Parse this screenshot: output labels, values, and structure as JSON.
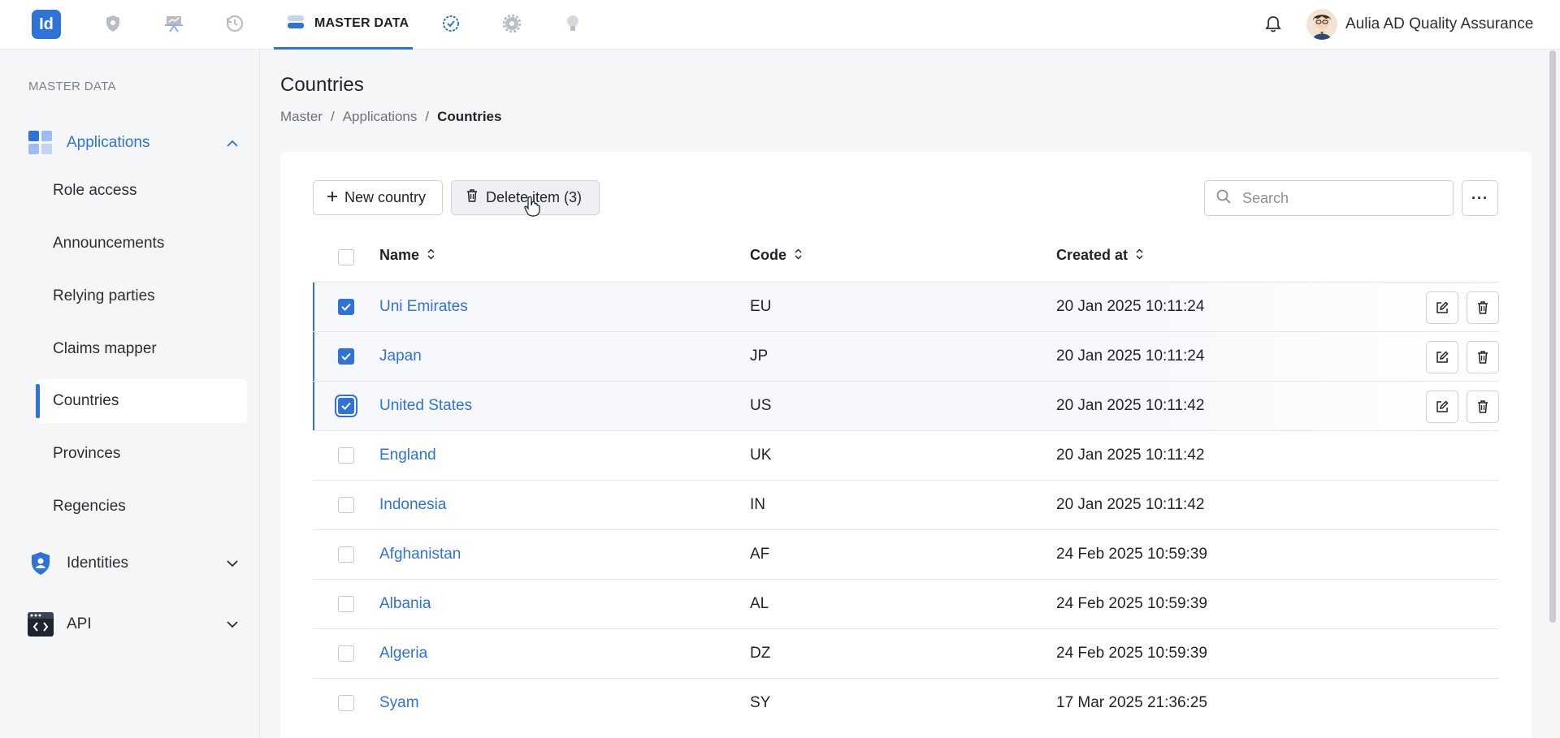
{
  "app": {
    "logo_text": "Id"
  },
  "topnav": {
    "active_label": "MASTER DATA",
    "icons": [
      "shield-icon",
      "presentation-icon",
      "history-icon",
      "master-data-icon",
      "check-circle-icon",
      "gear-icon",
      "lightbulb-icon"
    ]
  },
  "user": {
    "name": "Aulia AD Quality Assurance"
  },
  "sidebar": {
    "section_label": "MASTER DATA",
    "groups": {
      "applications": "Applications",
      "identities": "Identities",
      "api": "API"
    },
    "items": [
      {
        "label": "Role access"
      },
      {
        "label": "Announcements"
      },
      {
        "label": "Relying parties"
      },
      {
        "label": "Claims mapper"
      },
      {
        "label": "Countries"
      },
      {
        "label": "Provinces"
      },
      {
        "label": "Regencies"
      }
    ],
    "active_item": "Countries"
  },
  "page": {
    "title": "Countries",
    "breadcrumb": [
      "Master",
      "Applications",
      "Countries"
    ]
  },
  "toolbar": {
    "new_label": "New country",
    "delete_label": "Delete item (3)",
    "search_placeholder": "Search",
    "more_label": "···"
  },
  "table": {
    "columns": [
      "Name",
      "Code",
      "Created at"
    ],
    "rows": [
      {
        "name": "Uni Emirates",
        "code": "EU",
        "created": "20 Jan 2025 10:11:24",
        "selected": true
      },
      {
        "name": "Japan",
        "code": "JP",
        "created": "20 Jan 2025 10:11:24",
        "selected": true
      },
      {
        "name": "United States",
        "code": "US",
        "created": "20 Jan 2025 10:11:42",
        "selected": true
      },
      {
        "name": "England",
        "code": "UK",
        "created": "20 Jan 2025 10:11:42",
        "selected": false
      },
      {
        "name": "Indonesia",
        "code": "IN",
        "created": "20 Jan 2025 10:11:42",
        "selected": false
      },
      {
        "name": "Afghanistan",
        "code": "AF",
        "created": "24 Feb 2025 10:59:39",
        "selected": false
      },
      {
        "name": "Albania",
        "code": "AL",
        "created": "24 Feb 2025 10:59:39",
        "selected": false
      },
      {
        "name": "Algeria",
        "code": "DZ",
        "created": "24 Feb 2025 10:59:39",
        "selected": false
      },
      {
        "name": "Syam",
        "code": "SY",
        "created": "17 Mar 2025 21:36:25",
        "selected": false
      }
    ]
  },
  "colors": {
    "accent": "#2f73d8",
    "text": "#1f2328",
    "muted": "#6b7179",
    "border": "#cfd3d8"
  }
}
